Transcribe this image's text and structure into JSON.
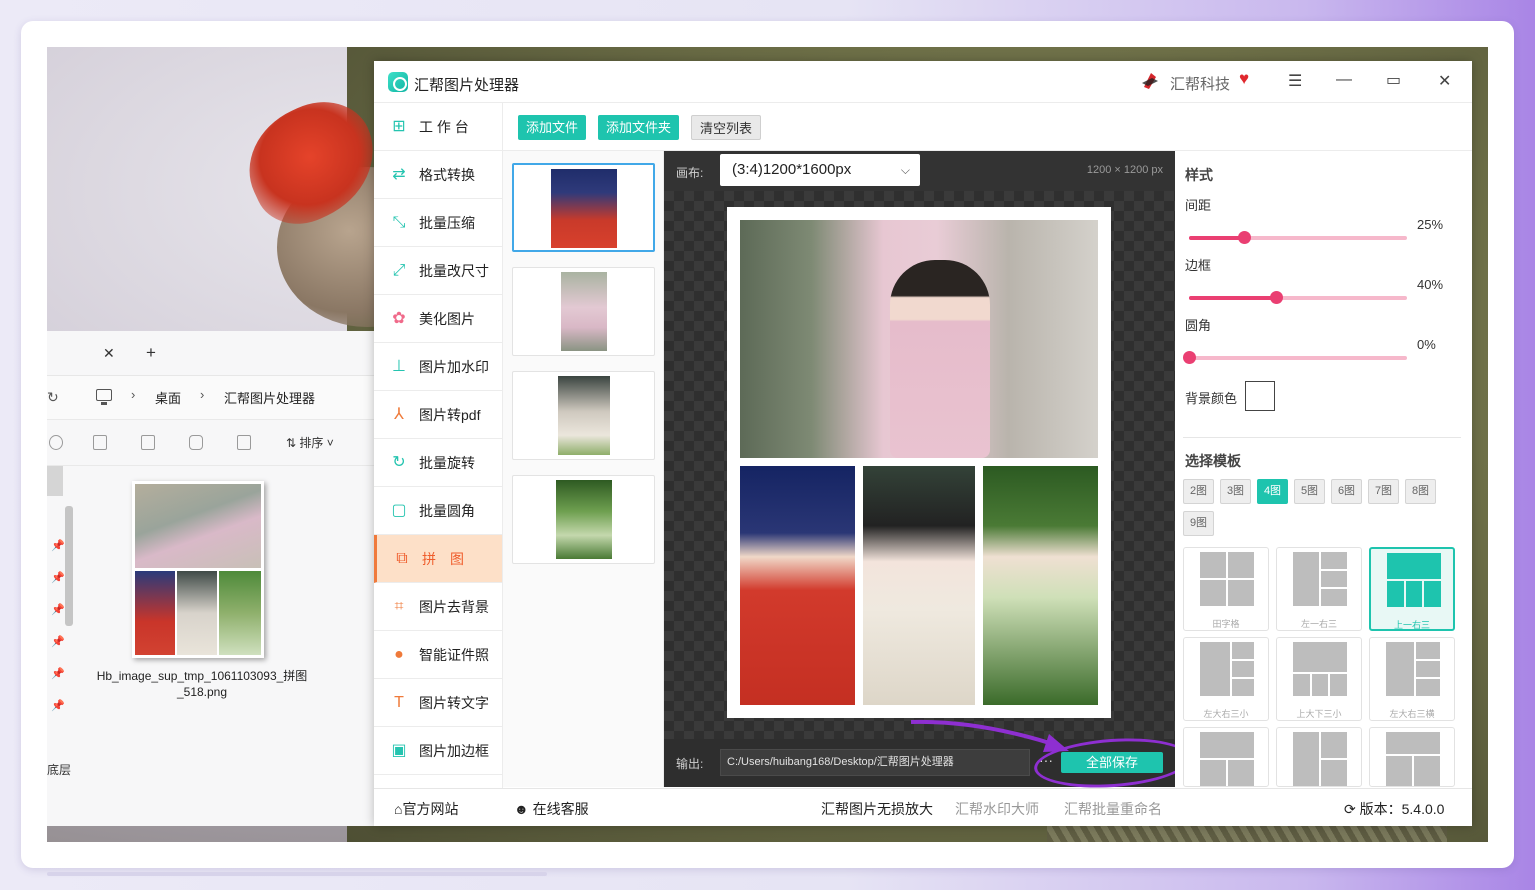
{
  "app": {
    "title": "汇帮图片处理器",
    "brand": "汇帮科技",
    "colors": {
      "accent": "#1ec4ae",
      "active_nav": "#ef5d2c",
      "slider": "#ea3f72",
      "annotation": "#8e2fd1"
    }
  },
  "sidebar": {
    "items": [
      {
        "label": "工 作 台",
        "icon": "grid-icon"
      },
      {
        "label": "格式转换",
        "icon": "convert-icon"
      },
      {
        "label": "批量压缩",
        "icon": "compress-icon"
      },
      {
        "label": "批量改尺寸",
        "icon": "resize-icon"
      },
      {
        "label": "美化图片",
        "icon": "beautify-icon"
      },
      {
        "label": "图片加水印",
        "icon": "watermark-icon"
      },
      {
        "label": "图片转pdf",
        "icon": "pdf-icon"
      },
      {
        "label": "批量旋转",
        "icon": "rotate-icon"
      },
      {
        "label": "批量圆角",
        "icon": "round-corner-icon"
      },
      {
        "label": "拼　图",
        "icon": "puzzle-icon",
        "active": true
      },
      {
        "label": "图片去背景",
        "icon": "crop-icon"
      },
      {
        "label": "智能证件照",
        "icon": "person-icon"
      },
      {
        "label": "图片转文字",
        "icon": "text-icon"
      },
      {
        "label": "图片加边框",
        "icon": "border-icon"
      }
    ]
  },
  "toolbar": {
    "add_file": "添加文件",
    "add_folder": "添加文件夹",
    "clear_list": "清空列表"
  },
  "preview": {
    "canvas_label": "画布:",
    "canvas_value": "(3:4)1200*1600px",
    "size_readout": "1200 × 1200 px",
    "output_label": "输出:",
    "output_path": "C:/Users/huibang168/Desktop/汇帮图片处理器",
    "more": "···",
    "save_all": "全部保存"
  },
  "settings": {
    "style_title": "样式",
    "spacing_label": "间距",
    "spacing_value": "25%",
    "spacing_level": 0.25,
    "border_label": "边框",
    "border_value": "40%",
    "border_level": 0.4,
    "radius_label": "圆角",
    "radius_value": "0%",
    "radius_level": 0.0,
    "bg_label": "背景颜色",
    "template_title": "选择模板",
    "counts": [
      "2图",
      "3图",
      "4图",
      "5图",
      "6图",
      "7图",
      "8图",
      "9图"
    ],
    "active_count": "4图",
    "templates": [
      {
        "name": "田字格"
      },
      {
        "name": "左一右三"
      },
      {
        "name": "上一右三",
        "active": true
      },
      {
        "name": "左大右三小"
      },
      {
        "name": "上大下三小"
      },
      {
        "name": "左大右三横"
      },
      {
        "name": ""
      },
      {
        "name": ""
      },
      {
        "name": ""
      }
    ]
  },
  "statusbar": {
    "website": "官方网站",
    "support": "在线客服",
    "link1": "汇帮图片无损放大",
    "link2": "汇帮水印大师",
    "link3": "汇帮批量重命名",
    "version": "版本：5.4.0.0"
  },
  "explorer": {
    "breadcrumb_1": "桌面",
    "breadcrumb_2": "汇帮图片处理器",
    "sort": "排序",
    "file_name": "Hb_image_sup_tmp_1061103093_拼图_518.png",
    "bottom_label": "底层"
  }
}
